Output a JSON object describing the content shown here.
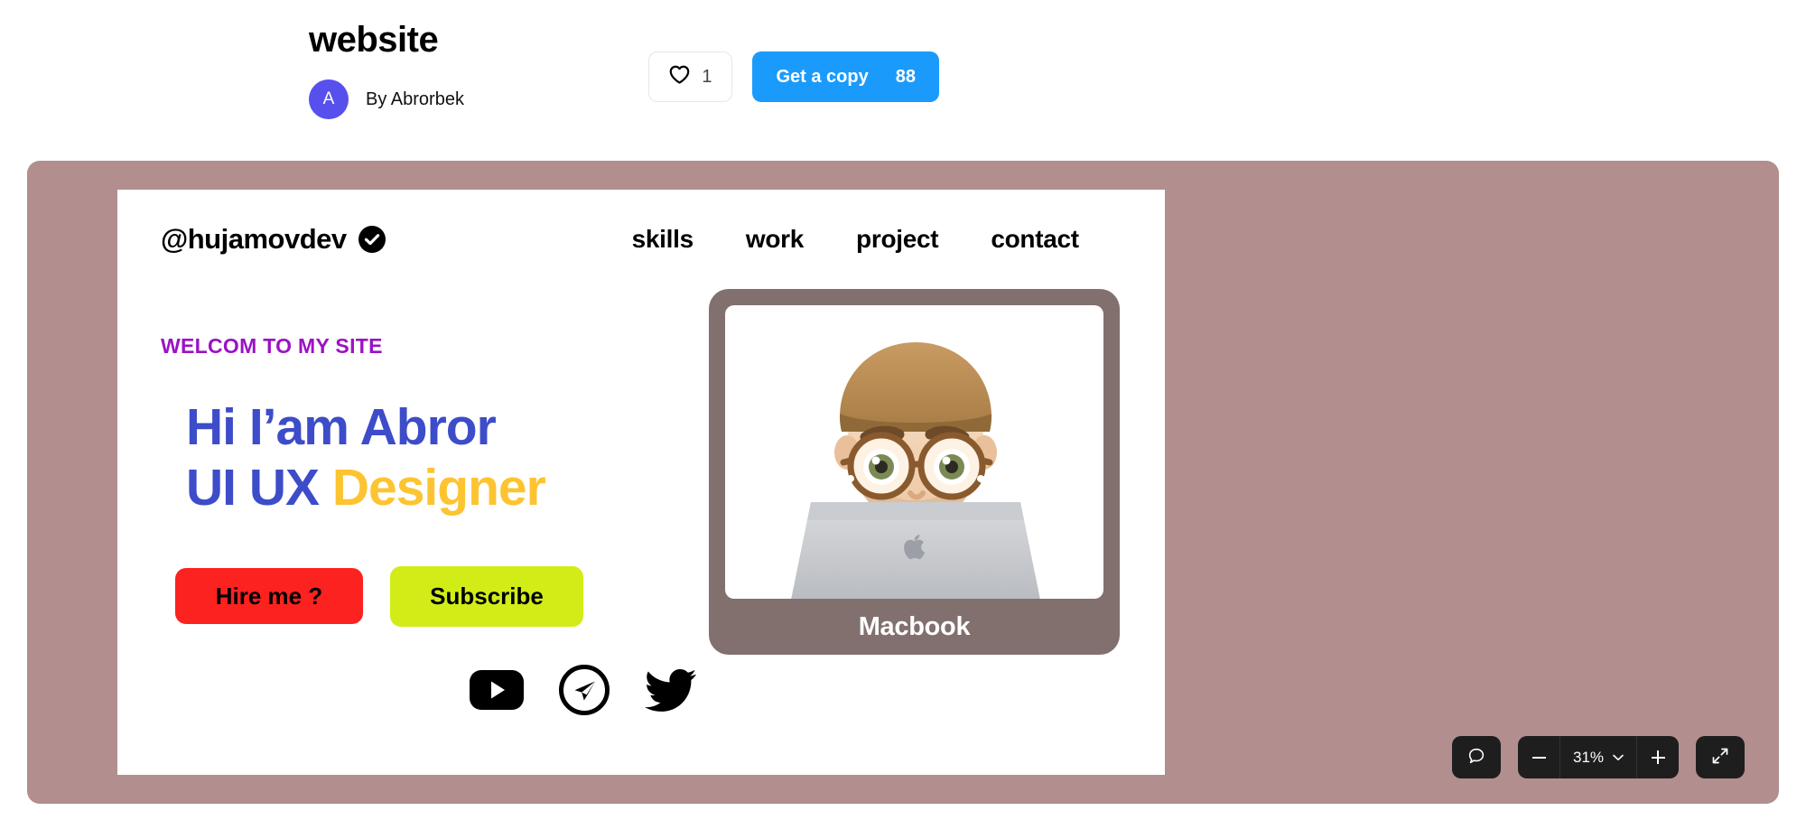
{
  "header": {
    "title": "website",
    "author_prefix": "By",
    "author_name": "By Abrorbek",
    "avatar_initial": "A",
    "avatar_color": "#5850ec",
    "like_count": "1",
    "like_icon": "heart-icon",
    "copy_label": "Get a copy",
    "copy_count": "88",
    "copy_button_color": "#1a9bfc"
  },
  "canvas": {
    "background_color": "#b28e8e"
  },
  "artboard": {
    "background_color": "#ffffff",
    "brand": {
      "handle": "@hujamovdev",
      "verified_icon": "verified-check-icon"
    },
    "nav": [
      {
        "label": "skills"
      },
      {
        "label": "work"
      },
      {
        "label": "project"
      },
      {
        "label": "contact"
      }
    ],
    "hero": {
      "eyebrow": "WELCOM TO MY SITE",
      "eyebrow_color": "#9c12c4",
      "title_line1": "Hi I’am Abror",
      "title_line2_blue": "UI UX ",
      "title_line2_yellow": "Designer",
      "title_blue_color": "#3d4cc9",
      "title_yellow_color": "#fdc431",
      "buttons": [
        {
          "label": "Hire me ?",
          "color": "#fc221f"
        },
        {
          "label": "Subscribe",
          "color": "#d2ec18"
        }
      ]
    },
    "socials": [
      {
        "name": "youtube-icon"
      },
      {
        "name": "telegram-icon"
      },
      {
        "name": "twitter-icon"
      }
    ],
    "device_card": {
      "label": "Macbook",
      "frame_color": "#82706e",
      "screen_color": "#ffffff",
      "illustration": "memoji-person-with-macbook"
    }
  },
  "toolbar": {
    "comment_icon": "comment-bubble-icon",
    "zoom_out_icon": "minus-icon",
    "zoom_level": "31%",
    "zoom_dropdown_icon": "chevron-down-icon",
    "zoom_in_icon": "plus-icon",
    "fullscreen_icon": "expand-arrows-icon"
  }
}
